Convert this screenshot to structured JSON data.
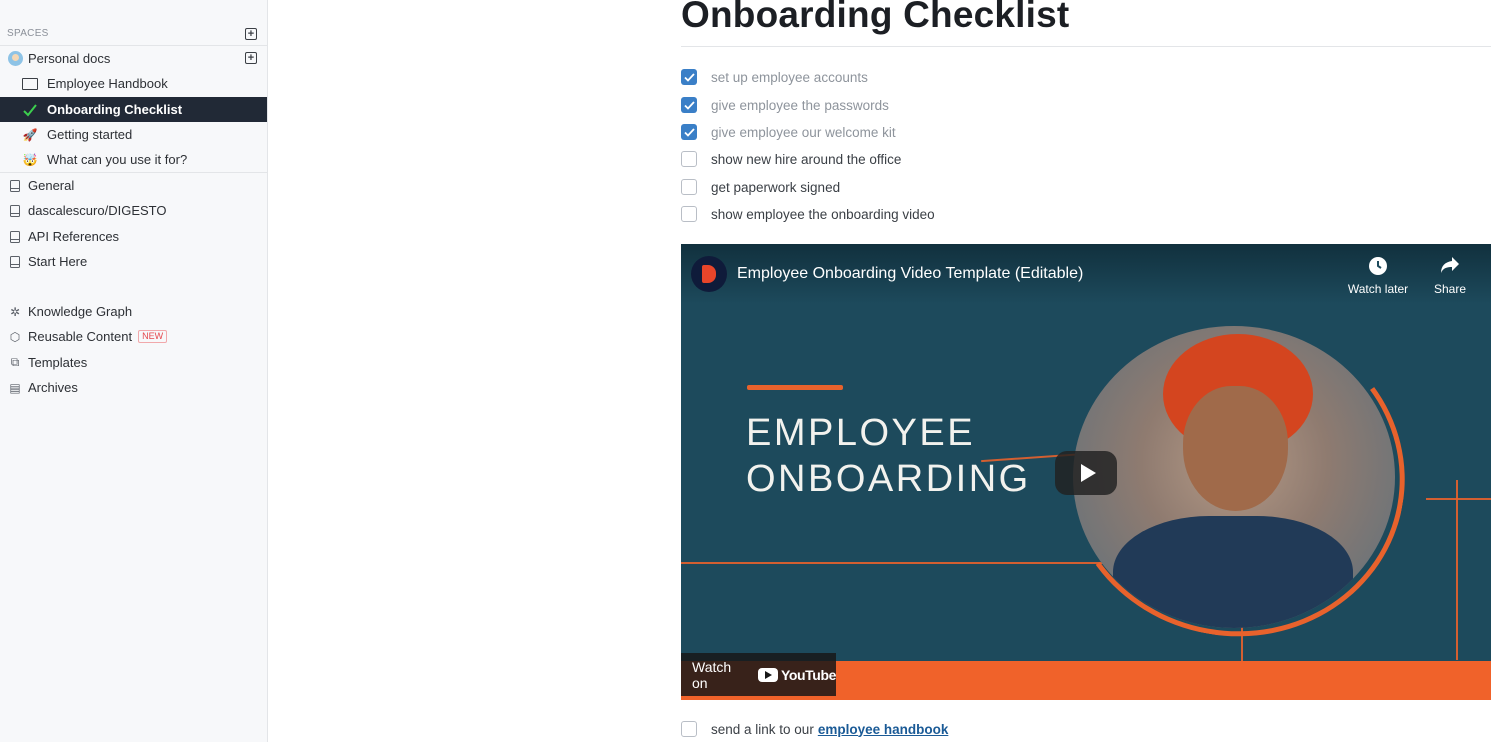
{
  "sidebar": {
    "spaces_label": "SPACES",
    "space": {
      "label": "Personal docs"
    },
    "pages": [
      {
        "label": "Employee Handbook",
        "icon": "laptop-icon"
      },
      {
        "label": "Onboarding Checklist",
        "icon": "check-icon",
        "active": true
      },
      {
        "label": "Getting started",
        "icon": "rocket-icon"
      },
      {
        "label": "What can you use it for?",
        "icon": "exploding-head-icon"
      }
    ],
    "collections": [
      {
        "label": "General"
      },
      {
        "label": "dascalescuro/DIGESTO"
      },
      {
        "label": "API References"
      },
      {
        "label": "Start Here"
      }
    ],
    "tools": [
      {
        "label": "Knowledge Graph",
        "icon": "graph-icon"
      },
      {
        "label": "Reusable Content",
        "icon": "cube-icon",
        "badge": "NEW"
      },
      {
        "label": "Templates",
        "icon": "copy-icon"
      },
      {
        "label": "Archives",
        "icon": "archive-icon"
      }
    ]
  },
  "main": {
    "title": "Onboarding Checklist",
    "tasks": [
      {
        "text": "set up employee accounts",
        "checked": true
      },
      {
        "text": "give employee the passwords",
        "checked": true
      },
      {
        "text": "give employee our welcome kit",
        "checked": true
      },
      {
        "text": "show new hire around the office",
        "checked": false
      },
      {
        "text": "get paperwork signed",
        "checked": false
      },
      {
        "text": "show employee the onboarding video",
        "checked": false
      }
    ],
    "video": {
      "title": "Employee Onboarding Video Template (Editable)",
      "watch_later": "Watch later",
      "share": "Share",
      "headline_1": "EMPLOYEE",
      "headline_2": "ONBOARDING",
      "watch_on": "Watch on",
      "youtube": "YouTube"
    },
    "last_task": {
      "text": "send a link to our",
      "link": "employee handbook",
      "checked": false
    }
  },
  "colors": {
    "accent": "#3a7fc7",
    "active_bg": "#212936",
    "video_orange": "#f0622a",
    "video_bg": "#1d4a5c"
  }
}
